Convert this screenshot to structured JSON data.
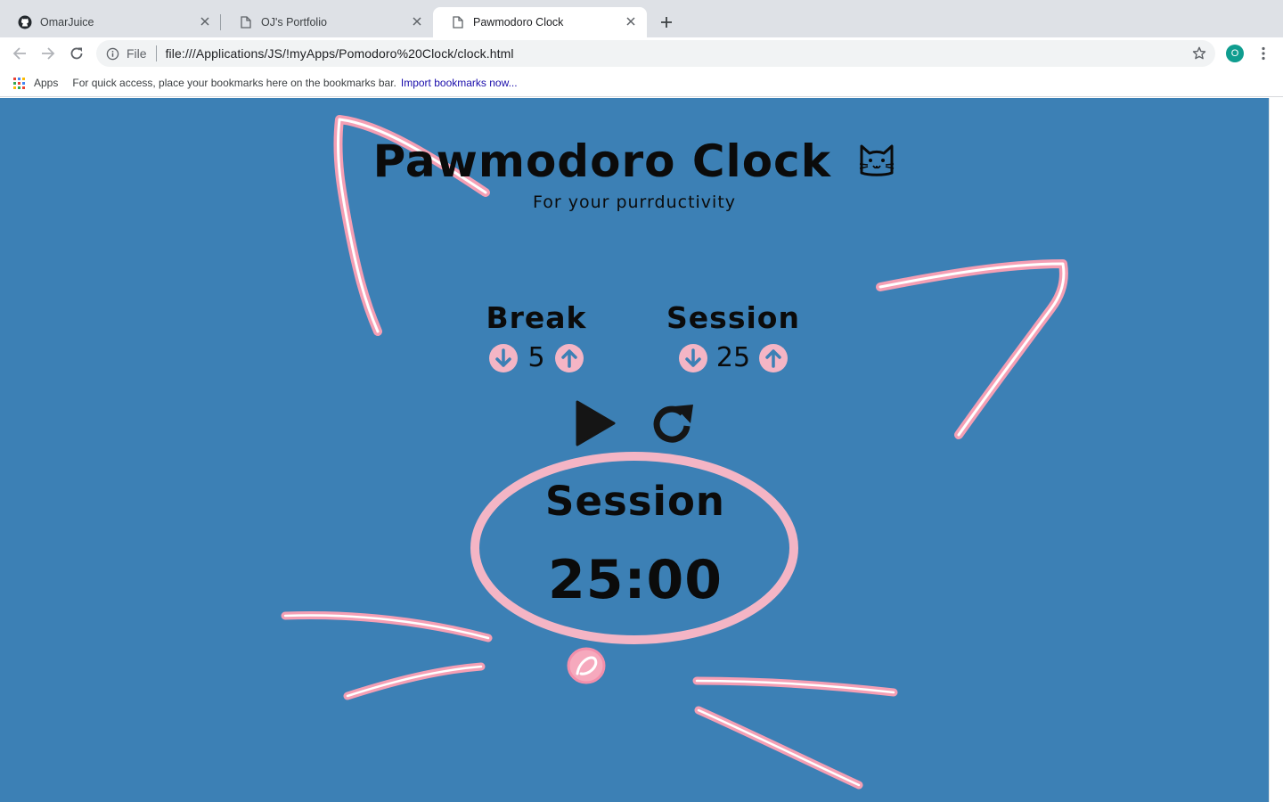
{
  "browser": {
    "tabs": [
      {
        "label": "OmarJuice",
        "icon": "github-icon"
      },
      {
        "label": "OJ's Portfolio",
        "icon": "page-icon"
      },
      {
        "label": "Pawmodoro Clock",
        "icon": "page-icon",
        "active": true
      }
    ],
    "omnibox": {
      "scheme": "File",
      "url": "file:///Applications/JS/!myApps/Pomodoro%20Clock/clock.html"
    },
    "profile_initial": "O"
  },
  "bookmarks": {
    "apps_label": "Apps",
    "hint": "For quick access, place your bookmarks here on the bookmarks bar.",
    "import_link": "Import bookmarks now..."
  },
  "app": {
    "title": "Pawmodoro Clock",
    "subtitle": "For your purrductivity",
    "break": {
      "label": "Break",
      "value": "5"
    },
    "session": {
      "label": "Session",
      "value": "25"
    },
    "timer": {
      "label": "Session",
      "time": "25:00"
    }
  },
  "colors": {
    "page_background": "#3c80b5",
    "accent_pink": "#f4b5c5",
    "text": "#0b0b0b"
  }
}
